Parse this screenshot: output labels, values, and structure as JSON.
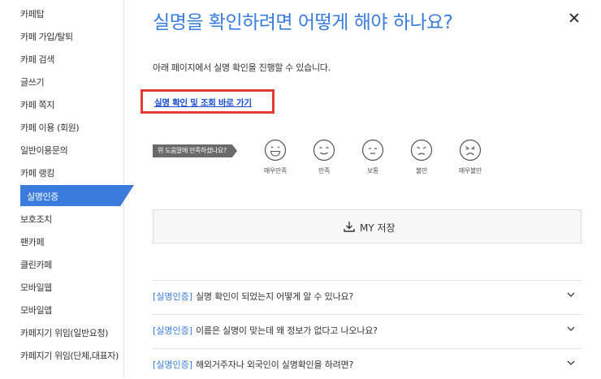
{
  "sidebar": {
    "items": [
      {
        "label": "카페탑"
      },
      {
        "label": "카페 가입/탈퇴"
      },
      {
        "label": "카페 검색"
      },
      {
        "label": "글쓰기"
      },
      {
        "label": "카페 쪽지"
      },
      {
        "label": "카페 이용 (회원)"
      },
      {
        "label": "일반이용문의"
      },
      {
        "label": "카페 랭킹"
      },
      {
        "label": "실명인증"
      },
      {
        "label": "보호조치"
      },
      {
        "label": "팬카페"
      },
      {
        "label": "클린카페"
      },
      {
        "label": "모바일웹"
      },
      {
        "label": "모바일앱"
      },
      {
        "label": "카페지기 위임(일반요청)"
      },
      {
        "label": "카페지기 위임(단체,대표자)"
      }
    ],
    "active_index": 8
  },
  "main": {
    "title": "실명을 확인하려면 어떻게 해야 하나요?",
    "description": "아래 페이지에서 실명 확인을 진행할 수 있습니다.",
    "link_label": "실명 확인 및 조회 바로 가기"
  },
  "satisfaction": {
    "question": "위 도움말에 만족하셨나요?",
    "options": [
      {
        "label": "매우만족",
        "icon": "very-satisfied-face-icon"
      },
      {
        "label": "만족",
        "icon": "satisfied-face-icon"
      },
      {
        "label": "보통",
        "icon": "neutral-face-icon"
      },
      {
        "label": "불만",
        "icon": "dissatisfied-face-icon"
      },
      {
        "label": "매우불만",
        "icon": "very-dissatisfied-face-icon"
      }
    ]
  },
  "save": {
    "label": "MY 저장",
    "icon": "download-icon"
  },
  "faq": [
    {
      "tag": "[실명인증]",
      "text": "실명 확인이 되었는지 어떻게 알 수 있나요?"
    },
    {
      "tag": "[실명인증]",
      "text": "이름은 실명이 맞는데 왜 정보가 없다고 나오나요?"
    },
    {
      "tag": "[실명인증]",
      "text": "해외거주자나 외국인이 실명확인을 하려면?"
    }
  ],
  "colors": {
    "accent": "#3a7bde",
    "highlight_box": "#e53935",
    "link": "#1a4cd1"
  }
}
